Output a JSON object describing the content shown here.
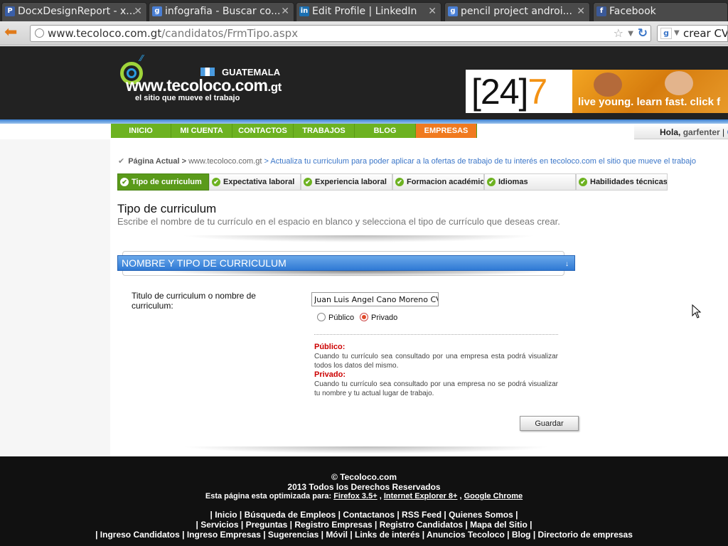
{
  "browser": {
    "tabs": [
      {
        "title": "DocxDesignReport - x...",
        "icon": "pdf-icon",
        "icon_glyph": "P",
        "icon_color": "#3a5fa8"
      },
      {
        "title": "infografia - Buscar co...",
        "icon": "google-search-icon",
        "icon_glyph": "g",
        "icon_color": "#4a7fd4"
      },
      {
        "title": "Edit Profile | LinkedIn",
        "icon": "linkedin-icon",
        "icon_glyph": "in",
        "icon_color": "#1b6fb0"
      },
      {
        "title": "pencil project androi...",
        "icon": "google-search-icon",
        "icon_glyph": "g",
        "icon_color": "#4a7fd4"
      },
      {
        "title": "Facebook",
        "icon": "facebook-icon",
        "icon_glyph": "f",
        "icon_color": "#3b5998"
      }
    ],
    "url_host": "www.tecoloco.com.gt",
    "url_path": "/candidatos/FrmTipo.aspx",
    "search_text": "crear CV c"
  },
  "header": {
    "country": "GUATEMALA",
    "site_name": "www.tecoloco.com",
    "site_tld": ".gt",
    "tagline": "el sitio que mueve el trabajo",
    "banner_num_a": "[24]",
    "banner_num_b": "7",
    "banner_tag": "live young. learn fast. click f"
  },
  "nav": {
    "items": [
      "INICIO",
      "MI CUENTA",
      "CONTACTOS",
      "TRABAJOS",
      "BLOG",
      "EMPRESAS"
    ],
    "greeting_label": "Hola,",
    "username": "garfenter",
    "greeting_sep": " | ",
    "greeting_next": "C"
  },
  "breadcrumb": {
    "check": "✔",
    "label": "Página Actual >",
    "site": "www.tecoloco.com.gt",
    "text": "> Actualiza tu curriculum para poder aplicar a la ofertas de trabajo de tu interés en tecoloco.com el sitio que mueve el trabajo"
  },
  "steps": [
    "Tipo de curriculum",
    "Expectativa laboral",
    "Experiencia laboral",
    "Formacion académica",
    "Idiomas",
    "Habilidades técnicas"
  ],
  "page": {
    "title": "Tipo de curriculum",
    "subtitle": "Escribe el nombre de tu currículo en el espacio en blanco y selecciona el tipo de currículo que deseas crear."
  },
  "section": {
    "title": "NOMBRE Y TIPO DE CURRICULUM",
    "arrow": "↓"
  },
  "form": {
    "field_label": "Titulo de curriculum o nombre de curriculum:",
    "name_value": "Juan Luis Angel Cano Moreno CV",
    "radio_public": "Público",
    "radio_private": "Privado",
    "selected": "Privado",
    "help_public_title": "Público:",
    "help_public_text": "Cuando tu currículo sea consultado por una empresa esta podrá visualizar todos los datos del mismo.",
    "help_private_title": "Privado:",
    "help_private_text": "Cuando tu currículo sea consultado por una empresa no se podrá visualizar tu nombre y tu actual lugar de trabajo.",
    "save_label": "Guardar"
  },
  "footer": {
    "copyright": "© Tecoloco.com",
    "rights": "2013 Todos los Derechos Reservados",
    "optimized_label": "Esta página esta optimizada para:",
    "browsers": [
      "Firefox 3.5+",
      "Internet Explorer 8+",
      "Google Chrome"
    ],
    "links_row1": [
      "Inicio",
      "Búsqueda de Empleos",
      "Contactanos",
      "RSS Feed",
      "Quienes Somos"
    ],
    "links_row2": [
      "Servicios",
      "Preguntas",
      "Registro Empresas",
      "Registro Candidatos",
      "Mapa del Sitio"
    ],
    "links_row3": [
      "Ingreso Candidatos",
      "Ingreso Empresas",
      "Sugerencias",
      "Móvil",
      "Links de interés",
      "Anuncios Tecoloco",
      "Blog",
      "Directorio de empresas"
    ]
  },
  "colors": {
    "nav_green": "#6db221",
    "nav_orange": "#f07a1f",
    "section_blue": "#2f79d4",
    "help_red": "#cc0000"
  }
}
